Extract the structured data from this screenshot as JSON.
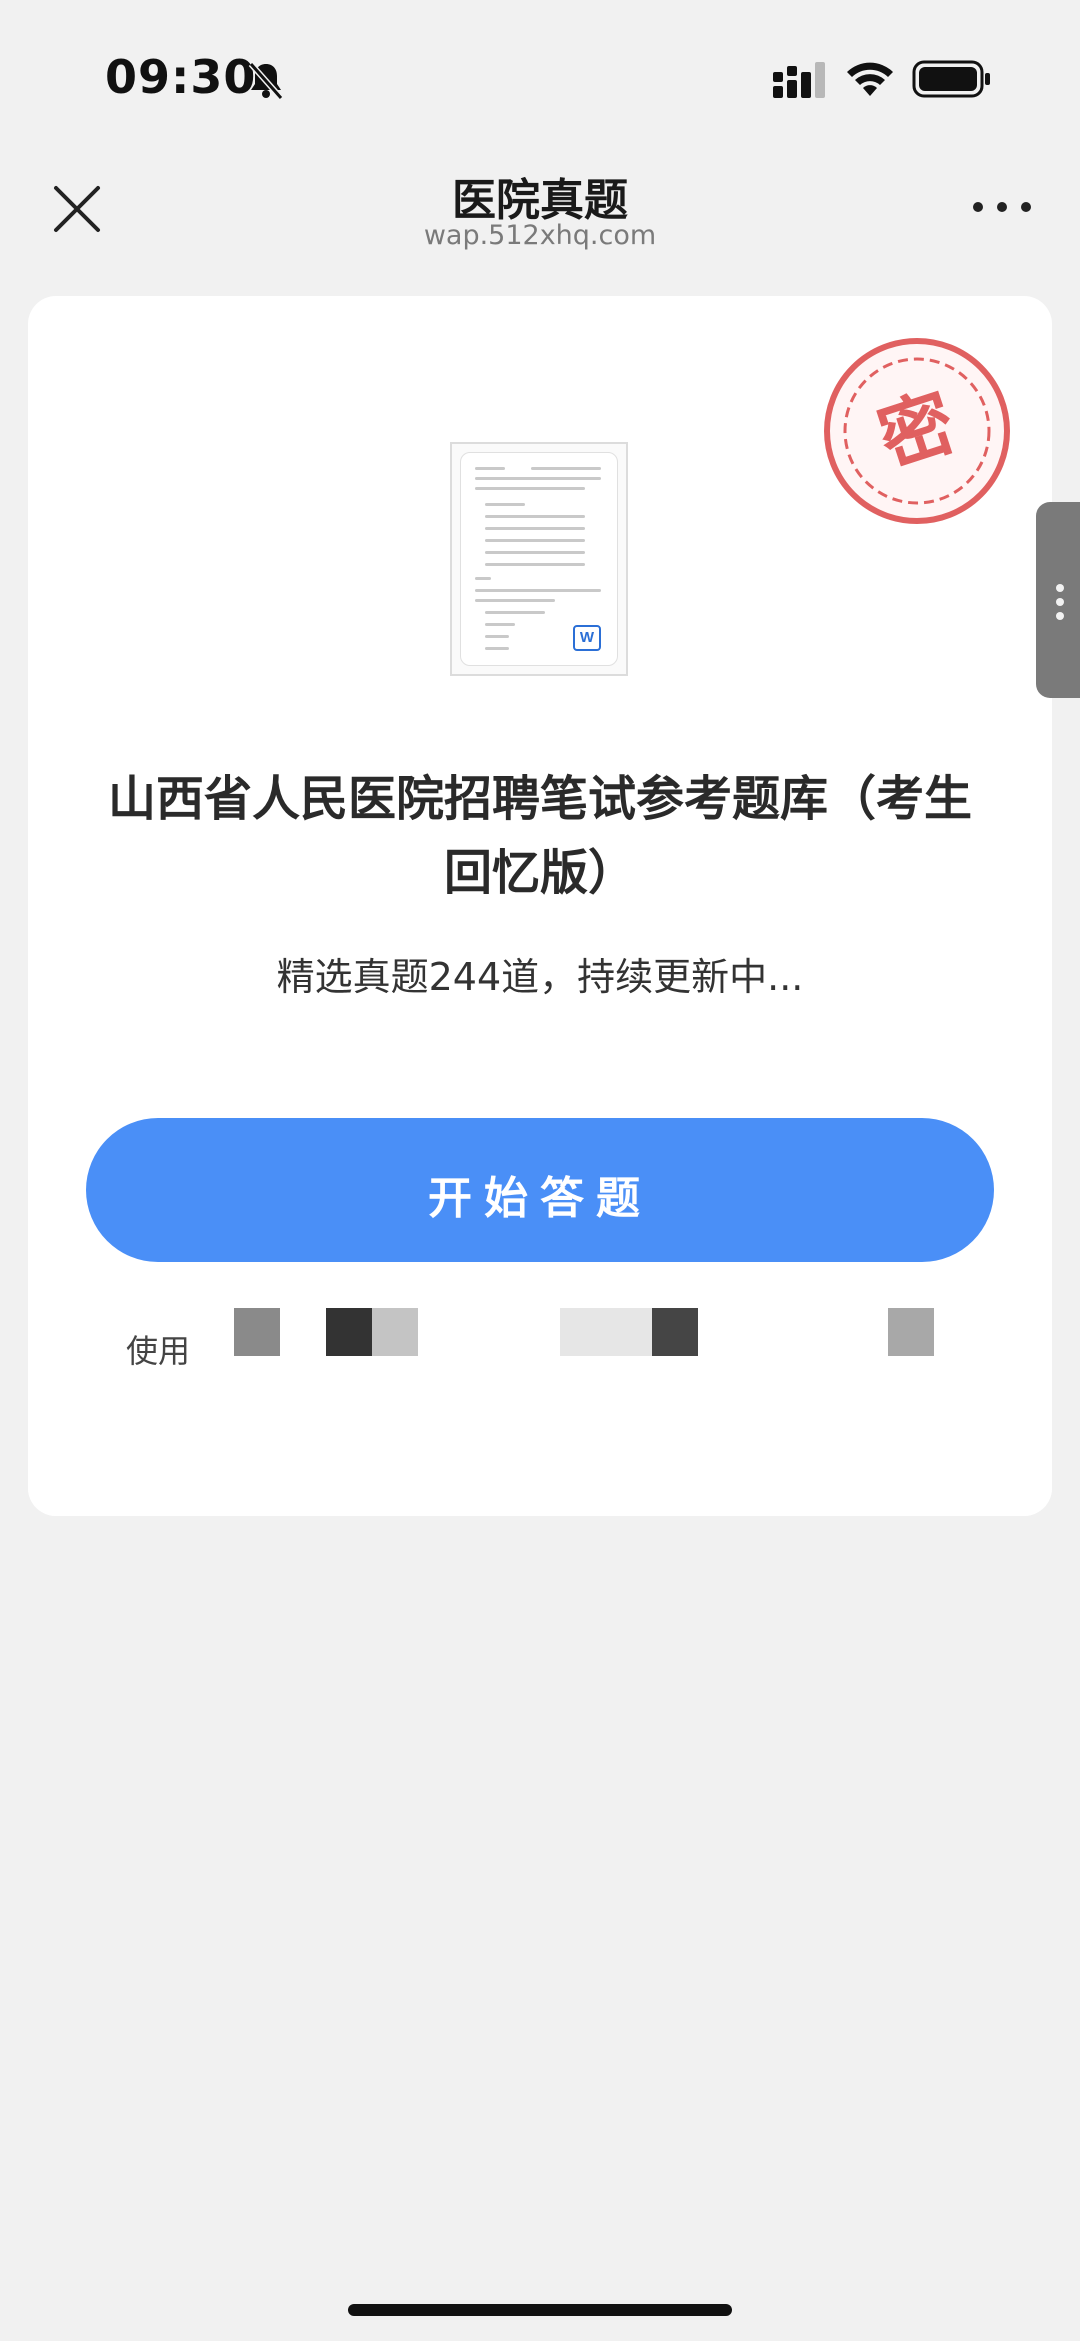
{
  "status_bar": {
    "time": "09:30",
    "icons": [
      "bell-muted-icon",
      "cellular-signal-icon",
      "wifi-icon",
      "battery-icon"
    ]
  },
  "nav": {
    "title": "医院真题",
    "url": "wap.512xhq.com",
    "close_icon": "close-icon",
    "more_icon": "more-dots-icon"
  },
  "card": {
    "stamp_text": "密",
    "doc_badge": "W",
    "title": "山西省人民医院招聘笔试参考题库（考生回忆版）",
    "subtitle": "精选真题244道，持续更新中...",
    "start_button_label": "开始答题",
    "usage_text_start": "使用"
  },
  "colors": {
    "accent": "#4a8ff7",
    "stamp": "#e06060",
    "background": "#f1f1f1",
    "card": "#ffffff"
  }
}
